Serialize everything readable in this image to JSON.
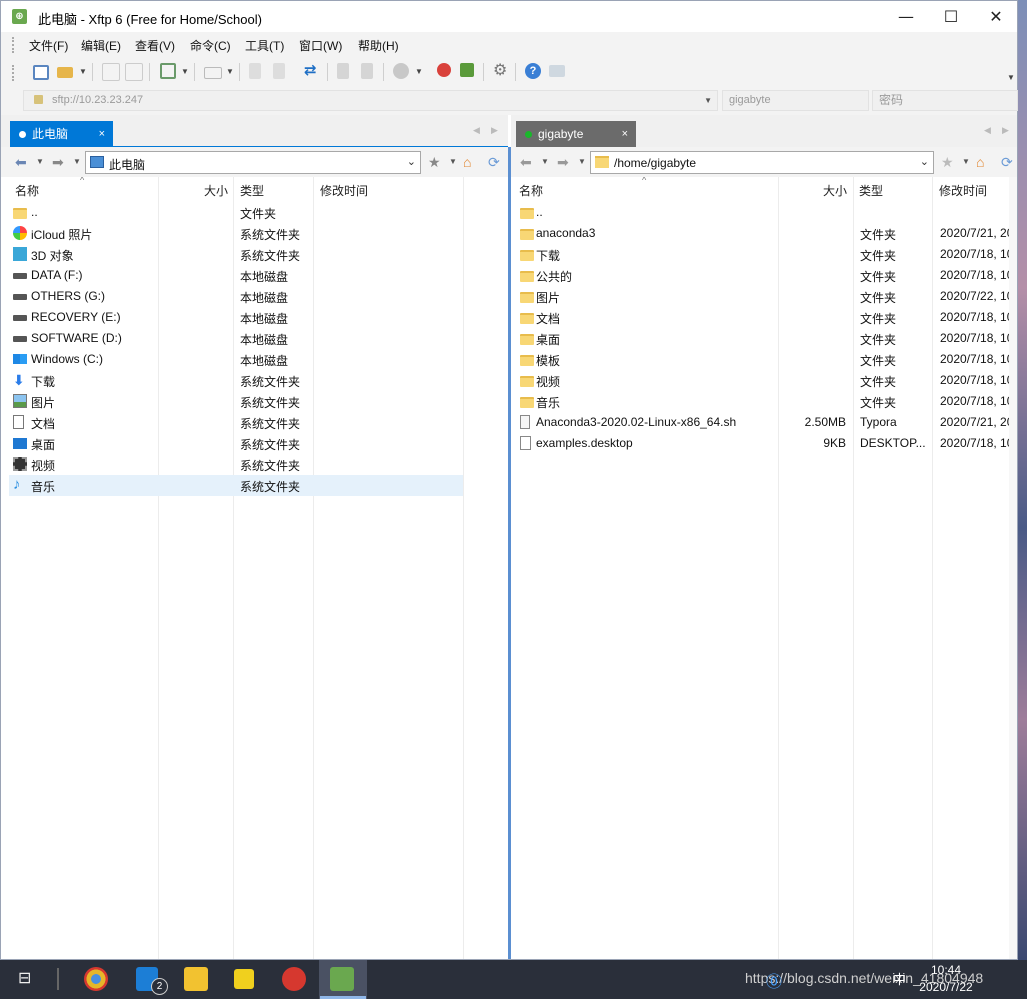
{
  "window": {
    "title": "此电脑 - Xftp 6 (Free for Home/School)"
  },
  "window_controls": {
    "minimize": "—",
    "maximize": "☐",
    "close": "✕"
  },
  "menu": [
    "文件(F)",
    "编辑(E)",
    "查看(V)",
    "命令(C)",
    "工具(T)",
    "窗口(W)",
    "帮助(H)"
  ],
  "address": {
    "host": "sftp://10.23.23.247",
    "username": "gigabyte",
    "password_placeholder": "密码"
  },
  "left_tab": {
    "label": "此电脑",
    "close": "×"
  },
  "right_tab": {
    "label": "gigabyte",
    "close": "×"
  },
  "left_path": "此电脑",
  "right_path": "/home/gigabyte",
  "columns": {
    "name": "名称",
    "size": "大小",
    "type": "类型",
    "modified": "修改时间"
  },
  "left_files": [
    {
      "name": "..",
      "size": "",
      "type": "文件夹",
      "icon": "folder-icon"
    },
    {
      "name": "iCloud 照片",
      "size": "",
      "type": "系统文件夹",
      "icon": "icloud-photos-icon"
    },
    {
      "name": "3D 对象",
      "size": "",
      "type": "系统文件夹",
      "icon": "3d-objects-icon"
    },
    {
      "name": "DATA (F:)",
      "size": "",
      "type": "本地磁盘",
      "icon": "drive-icon"
    },
    {
      "name": "OTHERS (G:)",
      "size": "",
      "type": "本地磁盘",
      "icon": "drive-icon"
    },
    {
      "name": "RECOVERY (E:)",
      "size": "",
      "type": "本地磁盘",
      "icon": "drive-icon"
    },
    {
      "name": "SOFTWARE (D:)",
      "size": "",
      "type": "本地磁盘",
      "icon": "drive-icon"
    },
    {
      "name": "Windows (C:)",
      "size": "",
      "type": "本地磁盘",
      "icon": "windows-drive-icon"
    },
    {
      "name": "下载",
      "size": "",
      "type": "系统文件夹",
      "icon": "download-icon"
    },
    {
      "name": "图片",
      "size": "",
      "type": "系统文件夹",
      "icon": "pictures-icon"
    },
    {
      "name": "文档",
      "size": "",
      "type": "系统文件夹",
      "icon": "documents-icon"
    },
    {
      "name": "桌面",
      "size": "",
      "type": "系统文件夹",
      "icon": "desktop-icon"
    },
    {
      "name": "视频",
      "size": "",
      "type": "系统文件夹",
      "icon": "videos-icon"
    },
    {
      "name": "音乐",
      "size": "",
      "type": "系统文件夹",
      "icon": "music-icon"
    }
  ],
  "right_files": [
    {
      "name": "..",
      "size": "",
      "type": "",
      "modified": "",
      "icon": "folder-icon"
    },
    {
      "name": "anaconda3",
      "size": "",
      "type": "文件夹",
      "modified": "2020/7/21, 20",
      "icon": "folder-icon"
    },
    {
      "name": "下载",
      "size": "",
      "type": "文件夹",
      "modified": "2020/7/18, 10",
      "icon": "folder-icon"
    },
    {
      "name": "公共的",
      "size": "",
      "type": "文件夹",
      "modified": "2020/7/18, 10",
      "icon": "folder-icon"
    },
    {
      "name": "图片",
      "size": "",
      "type": "文件夹",
      "modified": "2020/7/22, 10",
      "icon": "folder-icon"
    },
    {
      "name": "文档",
      "size": "",
      "type": "文件夹",
      "modified": "2020/7/18, 10",
      "icon": "folder-icon"
    },
    {
      "name": "桌面",
      "size": "",
      "type": "文件夹",
      "modified": "2020/7/18, 10",
      "icon": "folder-icon"
    },
    {
      "name": "模板",
      "size": "",
      "type": "文件夹",
      "modified": "2020/7/18, 10",
      "icon": "folder-icon"
    },
    {
      "name": "视频",
      "size": "",
      "type": "文件夹",
      "modified": "2020/7/18, 10",
      "icon": "folder-icon"
    },
    {
      "name": "音乐",
      "size": "",
      "type": "文件夹",
      "modified": "2020/7/18, 10",
      "icon": "folder-icon"
    },
    {
      "name": "Anaconda3-2020.02-Linux-x86_64.sh",
      "size": "2.50MB",
      "type": "Typora",
      "modified": "2020/7/21, 20",
      "icon": "script-file-icon"
    },
    {
      "name": "examples.desktop",
      "size": "9KB",
      "type": "DESKTOP...",
      "modified": "2020/7/18, 10",
      "icon": "file-icon"
    }
  ],
  "taskbar": {
    "badge": "2",
    "tray_text": "https://blog.csdn.net/weixin_41804948",
    "ime": "中",
    "time": "10:44",
    "date": "2020/7/22"
  },
  "colors": {
    "accent": "#0078d7",
    "right_tab": "#6b6b6b",
    "selection": "#e5f1fb"
  }
}
